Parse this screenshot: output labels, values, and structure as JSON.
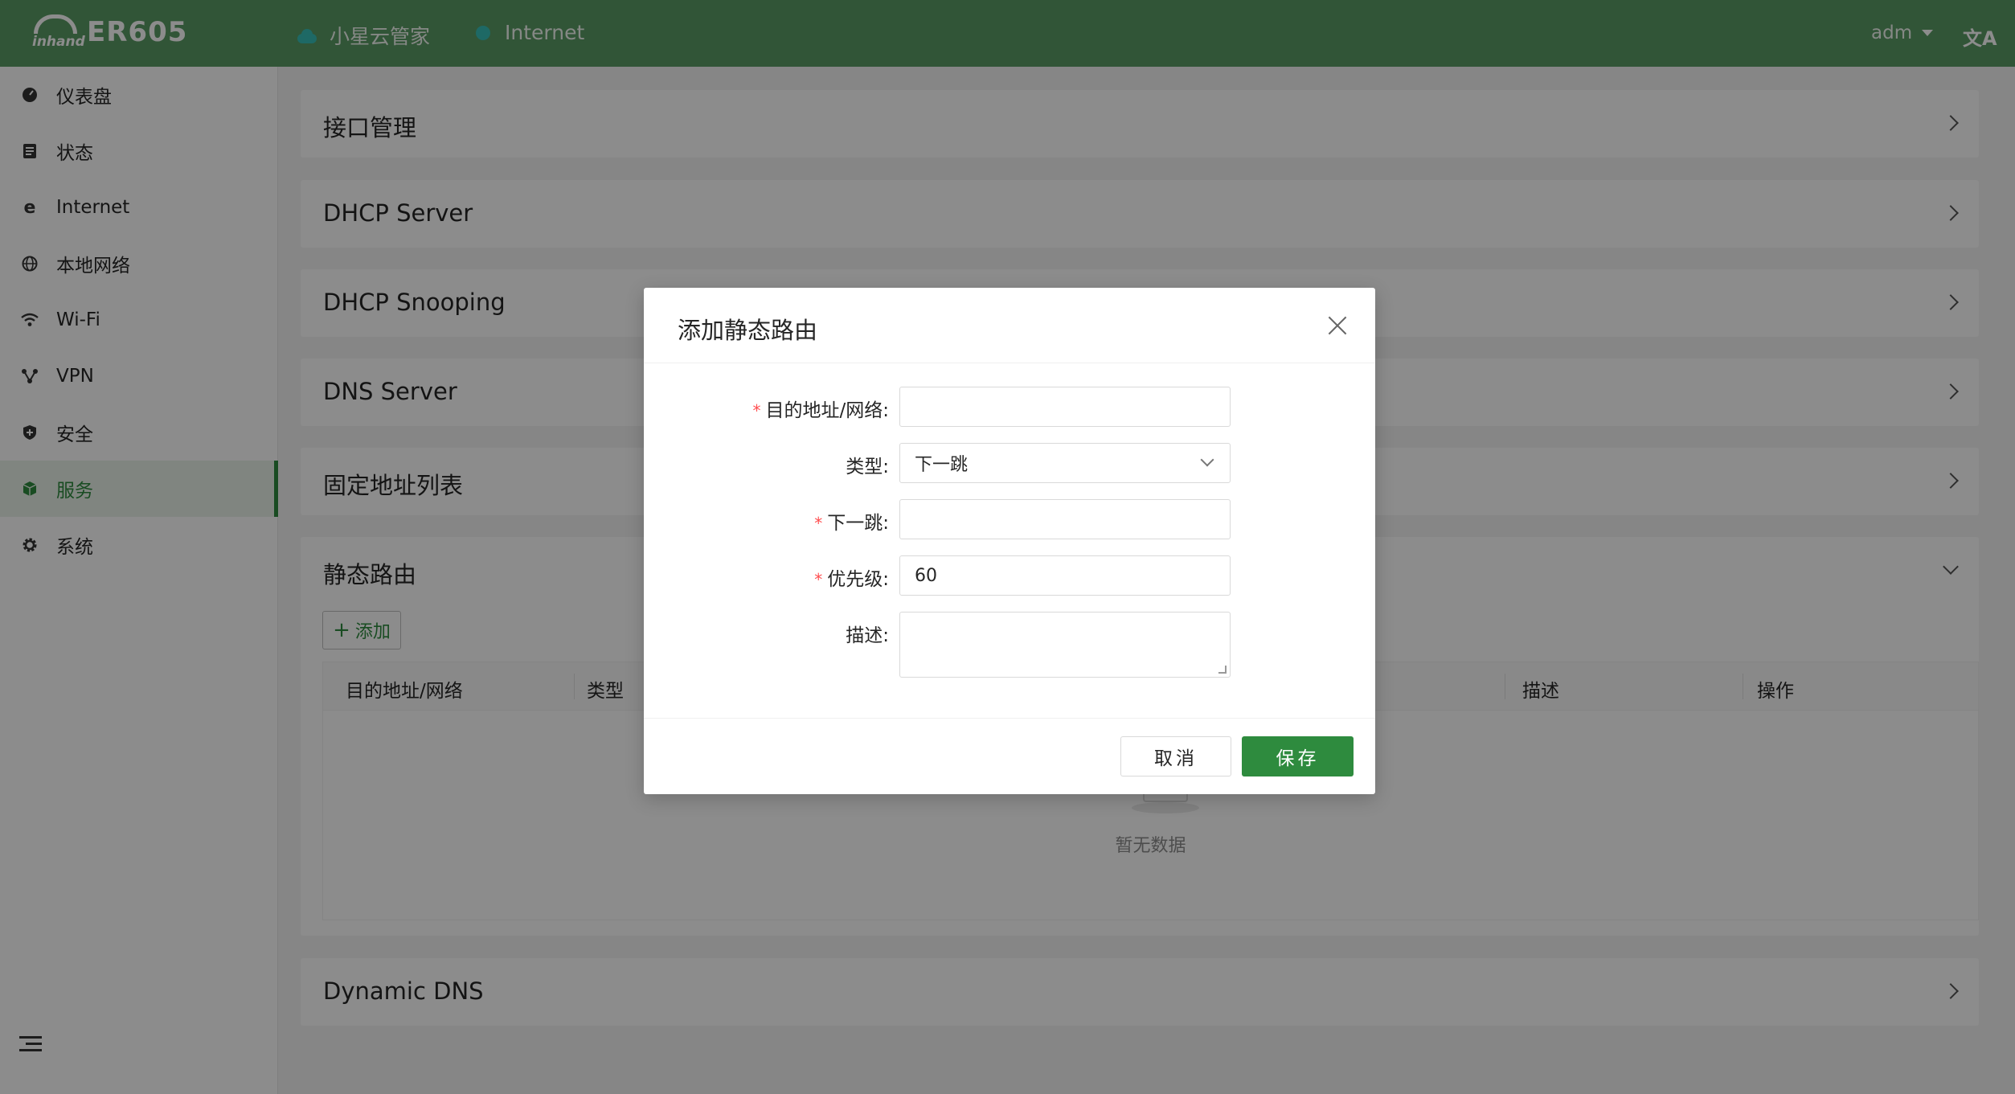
{
  "header": {
    "product": "ER605",
    "brand": "inhand",
    "cloud_label": "小星云管家",
    "internet_label": "Internet",
    "user": "adm",
    "lang_icon": "translate-icon"
  },
  "sidebar": {
    "items": [
      {
        "label": "仪表盘",
        "icon": "dashboard-icon"
      },
      {
        "label": "状态",
        "icon": "status-icon"
      },
      {
        "label": "Internet",
        "icon": "internet-icon"
      },
      {
        "label": "本地网络",
        "icon": "globe-icon"
      },
      {
        "label": "Wi-Fi",
        "icon": "wifi-icon"
      },
      {
        "label": "VPN",
        "icon": "vpn-icon"
      },
      {
        "label": "安全",
        "icon": "shield-icon"
      },
      {
        "label": "服务",
        "icon": "cube-icon"
      },
      {
        "label": "系统",
        "icon": "gear-icon"
      }
    ],
    "active": "服务"
  },
  "panels": {
    "interface": "接口管理",
    "dhcp_server": "DHCP Server",
    "dhcp_snooping": "DHCP Snooping",
    "dns_server": "DNS Server",
    "fixed_address": "固定地址列表",
    "static_route": "静态路由",
    "dynamic_dns": "Dynamic DNS"
  },
  "static_route": {
    "add_label": "添加",
    "columns": [
      "目的地址/网络",
      "类型",
      "描述",
      "操作"
    ],
    "empty_text": "暂无数据"
  },
  "modal": {
    "title": "添加静态路由",
    "fields": {
      "destination": {
        "label": "目的地址/网络:",
        "value": ""
      },
      "type": {
        "label": "类型:",
        "value": "下一跳"
      },
      "next_hop": {
        "label": "下一跳:",
        "value": ""
      },
      "priority": {
        "label": "优先级:",
        "value": "60"
      },
      "description": {
        "label": "描述:",
        "value": ""
      }
    },
    "cancel_label": "取消",
    "save_label": "保存"
  },
  "colors": {
    "header_bg": "#5a9b64",
    "accent": "#2e8b3e",
    "status_dot": "#37c0b8",
    "required": "#ff4d4f"
  }
}
